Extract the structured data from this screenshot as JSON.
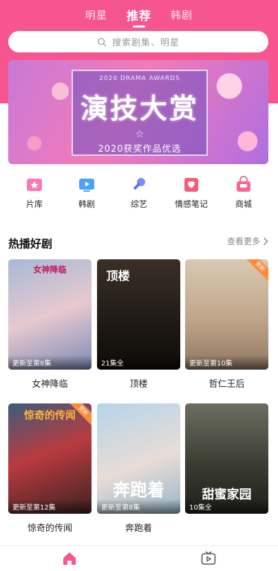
{
  "colors": {
    "brand": "#f7558f",
    "accent_orange": "#ff8a3c"
  },
  "header": {
    "tabs": [
      {
        "label": "明星",
        "active": false
      },
      {
        "label": "推荐",
        "active": true
      },
      {
        "label": "韩剧",
        "active": false
      }
    ],
    "search": {
      "placeholder": "搜索剧集、明星",
      "icon": "search-icon"
    }
  },
  "banner": {
    "awards_text": "2020 DRAMA AWARDS",
    "headline": "演技大赏",
    "subtitle": "2020获奖作品优选"
  },
  "quick_nav": [
    {
      "label": "片库",
      "icon": "star-folder-icon"
    },
    {
      "label": "韩剧",
      "icon": "play-tv-icon"
    },
    {
      "label": "综艺",
      "icon": "microphone-icon"
    },
    {
      "label": "情感笔记",
      "icon": "heart-note-icon"
    },
    {
      "label": "商城",
      "icon": "shop-bag-icon"
    }
  ],
  "section": {
    "title": "热播好剧",
    "more_label": "查看更多"
  },
  "dramas": [
    {
      "title": "女神降临",
      "status": "更新至第8集",
      "poster_text": "女神降临",
      "tag": ""
    },
    {
      "title": "顶楼",
      "status": "21集全",
      "poster_text": "顶楼",
      "tag": ""
    },
    {
      "title": "哲仁王后",
      "status": "更新至第10集",
      "poster_text": "",
      "tag": "更新"
    },
    {
      "title": "惊奇的传闻",
      "status": "更新至第12集",
      "poster_text": "惊奇的传闻",
      "tag": "更新"
    },
    {
      "title": "奔跑着",
      "status": "更新至第8集",
      "poster_text": "奔跑着",
      "tag": ""
    },
    {
      "title": "",
      "status": "10集全",
      "poster_text": "甜蜜家园",
      "tag": ""
    }
  ],
  "bottom_nav": [
    {
      "icon": "home-icon",
      "active": true
    },
    {
      "icon": "tv-play-icon",
      "active": false
    }
  ]
}
